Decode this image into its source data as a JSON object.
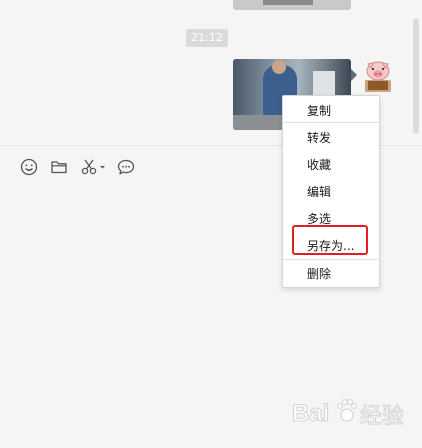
{
  "chat": {
    "timestamp": "21:12"
  },
  "toolbar": {
    "icons": [
      "emoji-icon",
      "folder-icon",
      "scissors-icon",
      "chat-bubble-icon"
    ]
  },
  "context_menu": {
    "items": [
      {
        "label": "复制"
      },
      {
        "label": "转发"
      },
      {
        "label": "收藏"
      },
      {
        "label": "编辑"
      },
      {
        "label": "多选"
      },
      {
        "label": "另存为..."
      },
      {
        "label": "删除"
      }
    ]
  },
  "watermark": {
    "text": "Bai 经验"
  },
  "colors": {
    "background": "#f5f5f5",
    "menu_bg": "#ffffff",
    "highlight": "#e02020",
    "timestamp_bg": "#dadada"
  }
}
